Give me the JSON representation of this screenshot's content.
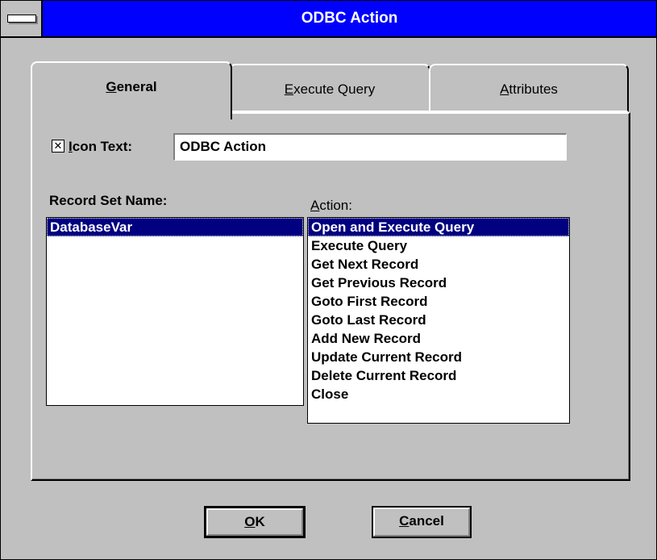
{
  "window": {
    "title": "ODBC Action"
  },
  "tabs": [
    {
      "prefix": "",
      "accel": "G",
      "rest": "eneral",
      "active": true
    },
    {
      "prefix": "",
      "accel": "E",
      "rest": "xecute Query",
      "active": false
    },
    {
      "prefix": "",
      "accel": "A",
      "rest": "ttributes",
      "active": false
    }
  ],
  "icon_text": {
    "checked": true,
    "check_mark": "✕",
    "label_accel": "I",
    "label_rest": "con Text:",
    "value": "ODBC Action"
  },
  "record_set": {
    "label": "Record Set Name:",
    "items": [
      "DatabaseVar"
    ],
    "selected_index": 0
  },
  "action": {
    "label_accel": "A",
    "label_rest": "ction:",
    "items": [
      "Open and Execute Query",
      "Execute Query",
      "Get Next Record",
      "Get Previous Record",
      "Goto First Record",
      "Goto Last Record",
      "Add New Record",
      "Update Current Record",
      "Delete Current Record",
      "Close"
    ],
    "selected_index": 0
  },
  "buttons": {
    "ok": {
      "accel": "O",
      "rest": "K"
    },
    "cancel": {
      "accel": "C",
      "rest": "ancel"
    }
  },
  "colors": {
    "title_bar": "#0000ff",
    "selection": "#000080",
    "face": "#c0c0c0"
  }
}
